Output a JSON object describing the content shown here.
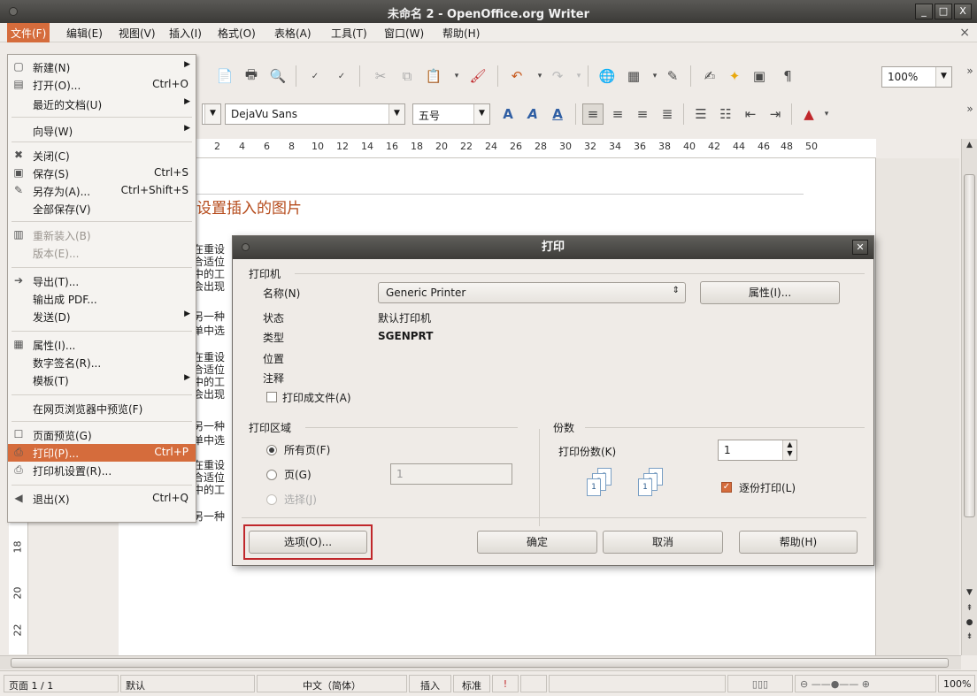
{
  "window": {
    "title": "未命名 2 - OpenOffice.org Writer",
    "controls": [
      "_",
      "□",
      "X"
    ]
  },
  "menubar": {
    "items": [
      "文件(F)",
      "编辑(E)",
      "视图(V)",
      "插入(I)",
      "格式(O)",
      "表格(A)",
      "工具(T)",
      "窗口(W)",
      "帮助(H)"
    ],
    "close": "×"
  },
  "toolbar": {
    "zoom": "100%",
    "font_name": "DejaVu Sans",
    "font_size": "五号",
    "more": "»"
  },
  "ruler": {
    "numbers": [
      "2",
      "4",
      "6",
      "8",
      "10",
      "12",
      "14",
      "16",
      "18",
      "20",
      "22",
      "24",
      "26",
      "28",
      "30",
      "32",
      "34",
      "36",
      "38",
      "40",
      "42",
      "44",
      "46",
      "48",
      "50"
    ]
  },
  "vruler": {
    "numbers": [
      "18",
      "20",
      "22"
    ]
  },
  "document": {
    "heading": "设置插入的图片",
    "fragments": [
      "在重设",
      "合适位",
      "中的工",
      "会出现",
      "另一种",
      "单中选",
      "在重设",
      "合适位",
      "中的工",
      "会出现",
      "另一种",
      "单中选",
      "在重设",
      "合适位",
      "中的工",
      "另一种"
    ]
  },
  "filemenu": {
    "items": [
      {
        "label": "新建(N)",
        "shortcut": "",
        "sub": true,
        "icon": "new-doc-icon",
        "glyph": "▢"
      },
      {
        "label": "打开(O)...",
        "shortcut": "Ctrl+O",
        "sub": false,
        "icon": "open-folder-icon",
        "glyph": "▤"
      },
      {
        "label": "最近的文档(U)",
        "shortcut": "",
        "sub": true,
        "icon": "",
        "glyph": ""
      },
      {
        "label": "向导(W)",
        "shortcut": "",
        "sub": true,
        "icon": "",
        "glyph": ""
      },
      {
        "label": "关闭(C)",
        "shortcut": "",
        "sub": false,
        "icon": "close-x-icon",
        "glyph": "✖"
      },
      {
        "label": "保存(S)",
        "shortcut": "Ctrl+S",
        "sub": false,
        "icon": "save-icon",
        "glyph": "▣"
      },
      {
        "label": "另存为(A)...",
        "shortcut": "Ctrl+Shift+S",
        "sub": false,
        "icon": "save-as-icon",
        "glyph": "✎"
      },
      {
        "label": "全部保存(V)",
        "shortcut": "",
        "sub": false,
        "icon": "",
        "glyph": ""
      },
      {
        "label": "重新装入(B)",
        "shortcut": "",
        "sub": false,
        "icon": "reload-icon",
        "glyph": "▥"
      },
      {
        "label": "版本(E)...",
        "shortcut": "",
        "sub": false,
        "icon": "",
        "glyph": ""
      },
      {
        "label": "导出(T)...",
        "shortcut": "",
        "sub": false,
        "icon": "export-icon",
        "glyph": "➔"
      },
      {
        "label": "输出成 PDF...",
        "shortcut": "",
        "sub": false,
        "icon": "",
        "glyph": ""
      },
      {
        "label": "发送(D)",
        "shortcut": "",
        "sub": true,
        "icon": "",
        "glyph": ""
      },
      {
        "label": "属性(I)...",
        "shortcut": "",
        "sub": false,
        "icon": "properties-icon",
        "glyph": "▦"
      },
      {
        "label": "数字签名(R)...",
        "shortcut": "",
        "sub": false,
        "icon": "",
        "glyph": ""
      },
      {
        "label": "模板(T)",
        "shortcut": "",
        "sub": true,
        "icon": "",
        "glyph": ""
      },
      {
        "label": "在网页浏览器中预览(F)",
        "shortcut": "",
        "sub": false,
        "icon": "",
        "glyph": ""
      },
      {
        "label": "页面预览(G)",
        "shortcut": "",
        "sub": false,
        "icon": "page-preview-icon",
        "glyph": "☐"
      },
      {
        "label": "打印(P)...",
        "shortcut": "Ctrl+P",
        "sub": false,
        "icon": "print-icon",
        "glyph": "⎙"
      },
      {
        "label": "打印机设置(R)...",
        "shortcut": "",
        "sub": false,
        "icon": "printer-settings-icon",
        "glyph": "⎙"
      },
      {
        "label": "退出(X)",
        "shortcut": "Ctrl+Q",
        "sub": false,
        "icon": "exit-icon",
        "glyph": "◀"
      }
    ]
  },
  "dialog": {
    "title": "打印",
    "printer_group": "打印机",
    "name_label": "名称(N)",
    "printer_name": "Generic Printer",
    "properties_button": "属性(I)...",
    "status_label": "状态",
    "status_value": "默认打印机",
    "type_label": "类型",
    "type_value": "SGENPRT",
    "location_label": "位置",
    "comment_label": "注释",
    "print_to_file": "打印成文件(A)",
    "range_group": "打印区域",
    "all_pages": "所有页(F)",
    "pages": "页(G)",
    "pages_value": "1",
    "selection": "选择(J)",
    "copies_group": "份数",
    "copies_label": "打印份数(K)",
    "copies_value": "1",
    "collate": "逐份打印(L)",
    "options_button": "选项(O)...",
    "ok_button": "确定",
    "cancel_button": "取消",
    "help_button": "帮助(H)"
  },
  "statusbar": {
    "page": "页面 1 / 1",
    "style": "默认",
    "language": "中文（简体）",
    "insert_mode": "插入",
    "selection_mode": "标准",
    "zoom": "100%"
  },
  "colors": {
    "accent": "#d56c3c",
    "title_bar": "#3b3a37",
    "heading": "#b54a1a",
    "highlight_box": "#c0272b"
  }
}
